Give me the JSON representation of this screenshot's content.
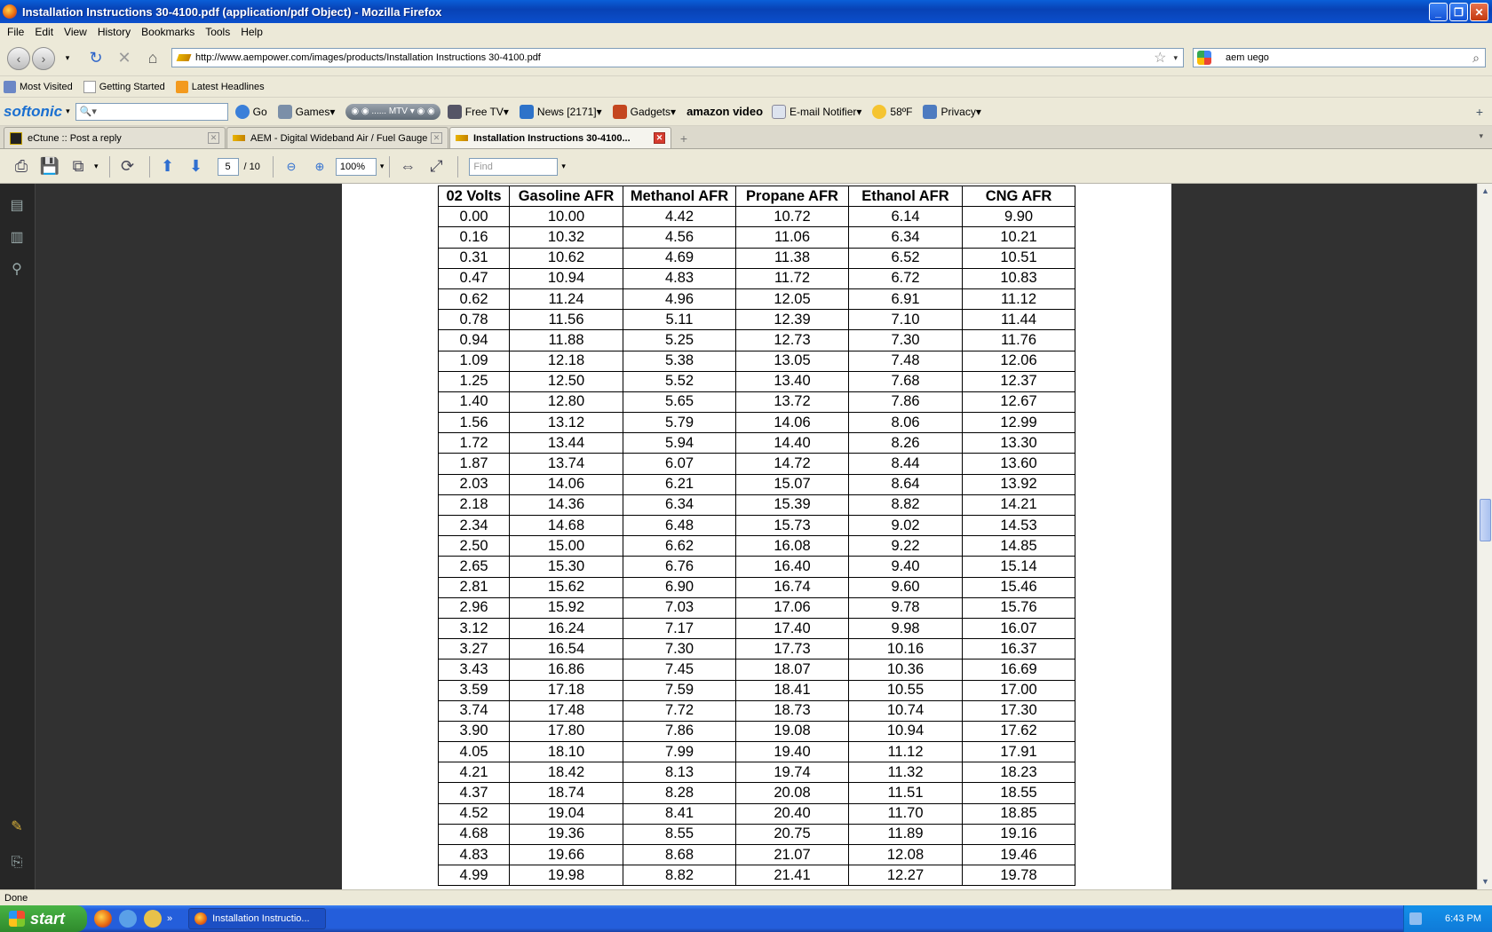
{
  "window": {
    "title": "Installation Instructions 30-4100.pdf (application/pdf Object) - Mozilla Firefox"
  },
  "menu": [
    "File",
    "Edit",
    "View",
    "History",
    "Bookmarks",
    "Tools",
    "Help"
  ],
  "nav": {
    "url": "http://www.aempower.com/images/products/Installation Instructions 30-4100.pdf",
    "search_query": "aem uego"
  },
  "bookmarks": [
    "Most Visited",
    "Getting Started",
    "Latest Headlines"
  ],
  "softonic": {
    "logo": "softonic",
    "search_placeholder": "🔍▾",
    "go": "Go",
    "games": "Games",
    "mtv": "MTV",
    "free_tv": "Free TV",
    "news": "News [2171]",
    "gadgets": "Gadgets",
    "amazon": "amazon video",
    "email": "E-mail Notifier",
    "weather": "58ºF",
    "privacy": "Privacy"
  },
  "tabs": [
    {
      "label": "eCtune :: Post a reply",
      "active": false
    },
    {
      "label": "AEM - Digital Wideband Air / Fuel Gauge",
      "active": false
    },
    {
      "label": "Installation Instructions 30-4100...",
      "active": true
    }
  ],
  "pdf": {
    "page": "5",
    "total": "/ 10",
    "zoom": "100%",
    "find_placeholder": "Find"
  },
  "table": {
    "headers": [
      "02 Volts",
      "Gasoline AFR",
      "Methanol AFR",
      "Propane AFR",
      "Ethanol AFR",
      "CNG AFR"
    ],
    "rows": [
      [
        "0.00",
        "10.00",
        "4.42",
        "10.72",
        "6.14",
        "9.90"
      ],
      [
        "0.16",
        "10.32",
        "4.56",
        "11.06",
        "6.34",
        "10.21"
      ],
      [
        "0.31",
        "10.62",
        "4.69",
        "11.38",
        "6.52",
        "10.51"
      ],
      [
        "0.47",
        "10.94",
        "4.83",
        "11.72",
        "6.72",
        "10.83"
      ],
      [
        "0.62",
        "11.24",
        "4.96",
        "12.05",
        "6.91",
        "11.12"
      ],
      [
        "0.78",
        "11.56",
        "5.11",
        "12.39",
        "7.10",
        "11.44"
      ],
      [
        "0.94",
        "11.88",
        "5.25",
        "12.73",
        "7.30",
        "11.76"
      ],
      [
        "1.09",
        "12.18",
        "5.38",
        "13.05",
        "7.48",
        "12.06"
      ],
      [
        "1.25",
        "12.50",
        "5.52",
        "13.40",
        "7.68",
        "12.37"
      ],
      [
        "1.40",
        "12.80",
        "5.65",
        "13.72",
        "7.86",
        "12.67"
      ],
      [
        "1.56",
        "13.12",
        "5.79",
        "14.06",
        "8.06",
        "12.99"
      ],
      [
        "1.72",
        "13.44",
        "5.94",
        "14.40",
        "8.26",
        "13.30"
      ],
      [
        "1.87",
        "13.74",
        "6.07",
        "14.72",
        "8.44",
        "13.60"
      ],
      [
        "2.03",
        "14.06",
        "6.21",
        "15.07",
        "8.64",
        "13.92"
      ],
      [
        "2.18",
        "14.36",
        "6.34",
        "15.39",
        "8.82",
        "14.21"
      ],
      [
        "2.34",
        "14.68",
        "6.48",
        "15.73",
        "9.02",
        "14.53"
      ],
      [
        "2.50",
        "15.00",
        "6.62",
        "16.08",
        "9.22",
        "14.85"
      ],
      [
        "2.65",
        "15.30",
        "6.76",
        "16.40",
        "9.40",
        "15.14"
      ],
      [
        "2.81",
        "15.62",
        "6.90",
        "16.74",
        "9.60",
        "15.46"
      ],
      [
        "2.96",
        "15.92",
        "7.03",
        "17.06",
        "9.78",
        "15.76"
      ],
      [
        "3.12",
        "16.24",
        "7.17",
        "17.40",
        "9.98",
        "16.07"
      ],
      [
        "3.27",
        "16.54",
        "7.30",
        "17.73",
        "10.16",
        "16.37"
      ],
      [
        "3.43",
        "16.86",
        "7.45",
        "18.07",
        "10.36",
        "16.69"
      ],
      [
        "3.59",
        "17.18",
        "7.59",
        "18.41",
        "10.55",
        "17.00"
      ],
      [
        "3.74",
        "17.48",
        "7.72",
        "18.73",
        "10.74",
        "17.30"
      ],
      [
        "3.90",
        "17.80",
        "7.86",
        "19.08",
        "10.94",
        "17.62"
      ],
      [
        "4.05",
        "18.10",
        "7.99",
        "19.40",
        "11.12",
        "17.91"
      ],
      [
        "4.21",
        "18.42",
        "8.13",
        "19.74",
        "11.32",
        "18.23"
      ],
      [
        "4.37",
        "18.74",
        "8.28",
        "20.08",
        "11.51",
        "18.55"
      ],
      [
        "4.52",
        "19.04",
        "8.41",
        "20.40",
        "11.70",
        "18.85"
      ],
      [
        "4.68",
        "19.36",
        "8.55",
        "20.75",
        "11.89",
        "19.16"
      ],
      [
        "4.83",
        "19.66",
        "8.68",
        "21.07",
        "12.08",
        "19.46"
      ],
      [
        "4.99",
        "19.98",
        "8.82",
        "21.41",
        "12.27",
        "19.78"
      ]
    ]
  },
  "status": "Done",
  "taskbar": {
    "start": "start",
    "task": "Installation Instructio...",
    "time": "6:43 PM"
  }
}
